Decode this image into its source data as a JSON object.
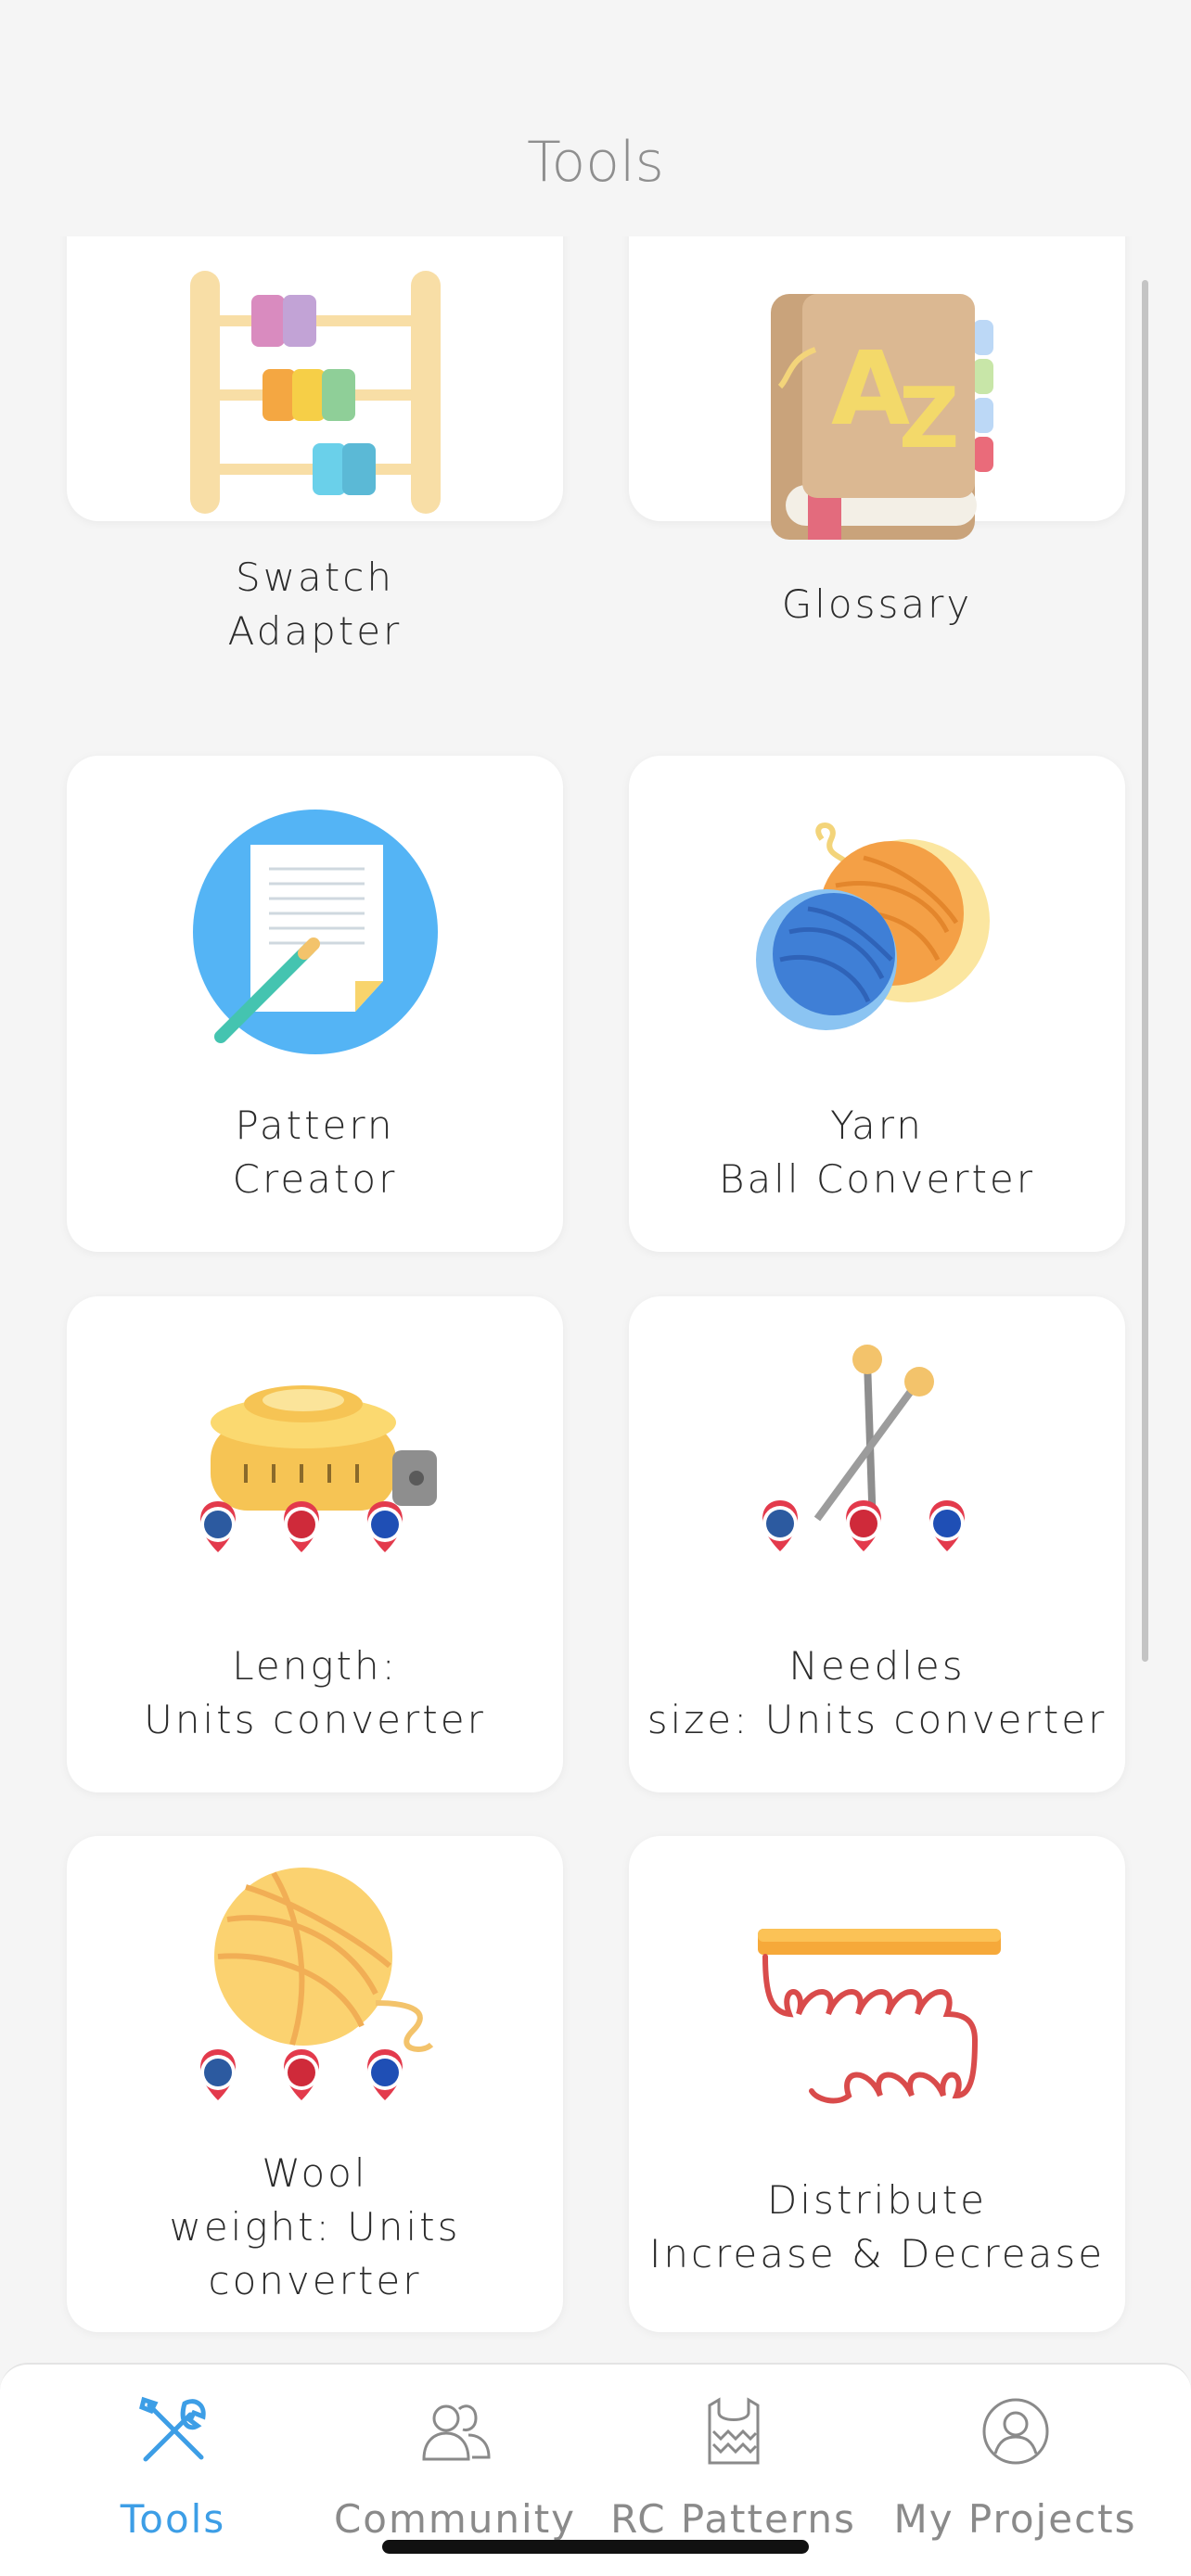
{
  "header": {
    "title": "Tools"
  },
  "tools": [
    {
      "label": "Swatch\nAdapter",
      "icon": "abacus-icon"
    },
    {
      "label": "Glossary",
      "icon": "glossary-book-icon"
    },
    {
      "label": "Pattern\nCreator",
      "icon": "pattern-document-icon"
    },
    {
      "label": "Yarn\nBall Converter",
      "icon": "yarn-balls-icon"
    },
    {
      "label": "Length:\nUnits converter",
      "icon": "tape-measure-flags-icon"
    },
    {
      "label": "Needles\nsize: Units converter",
      "icon": "knitting-needles-flags-icon"
    },
    {
      "label": "Wool\nweight: Units\nconverter",
      "icon": "wool-ball-flags-icon"
    },
    {
      "label": "Distribute\nIncrease & Decrease",
      "icon": "stitches-needle-icon"
    }
  ],
  "tabbar": {
    "tabs": [
      {
        "label": "Tools",
        "icon": "tools-icon",
        "active": true
      },
      {
        "label": "Community",
        "icon": "community-icon",
        "active": false
      },
      {
        "label": "RC Patterns",
        "icon": "sweater-icon",
        "active": false
      },
      {
        "label": "My Projects",
        "icon": "profile-icon",
        "active": false
      }
    ]
  },
  "colors": {
    "accent": "#3d9ee6",
    "background": "#f5f5f5",
    "card": "#ffffff",
    "inactive_tab": "#8a8a8a"
  }
}
